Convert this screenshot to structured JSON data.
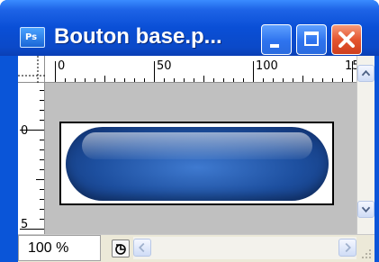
{
  "window": {
    "title": "Bouton base.p...",
    "app_icon_text": "Ps"
  },
  "rulers": {
    "top_labels": [
      "0",
      "50",
      "100",
      "15"
    ],
    "left_labels": [
      "0",
      "5"
    ]
  },
  "status": {
    "zoom": "100 %"
  },
  "colors": {
    "titlebar": "#0a4fd6",
    "close_button": "#e45530",
    "canvas_background": "#c0c0c0",
    "button_graphic": "#1d4f9f"
  },
  "icons": {
    "app": "photoshop-document-icon",
    "minimize": "minimize-icon",
    "maximize": "maximize-icon",
    "close": "close-icon",
    "status": "status-info-icon",
    "grip": "resize-grip-icon"
  }
}
